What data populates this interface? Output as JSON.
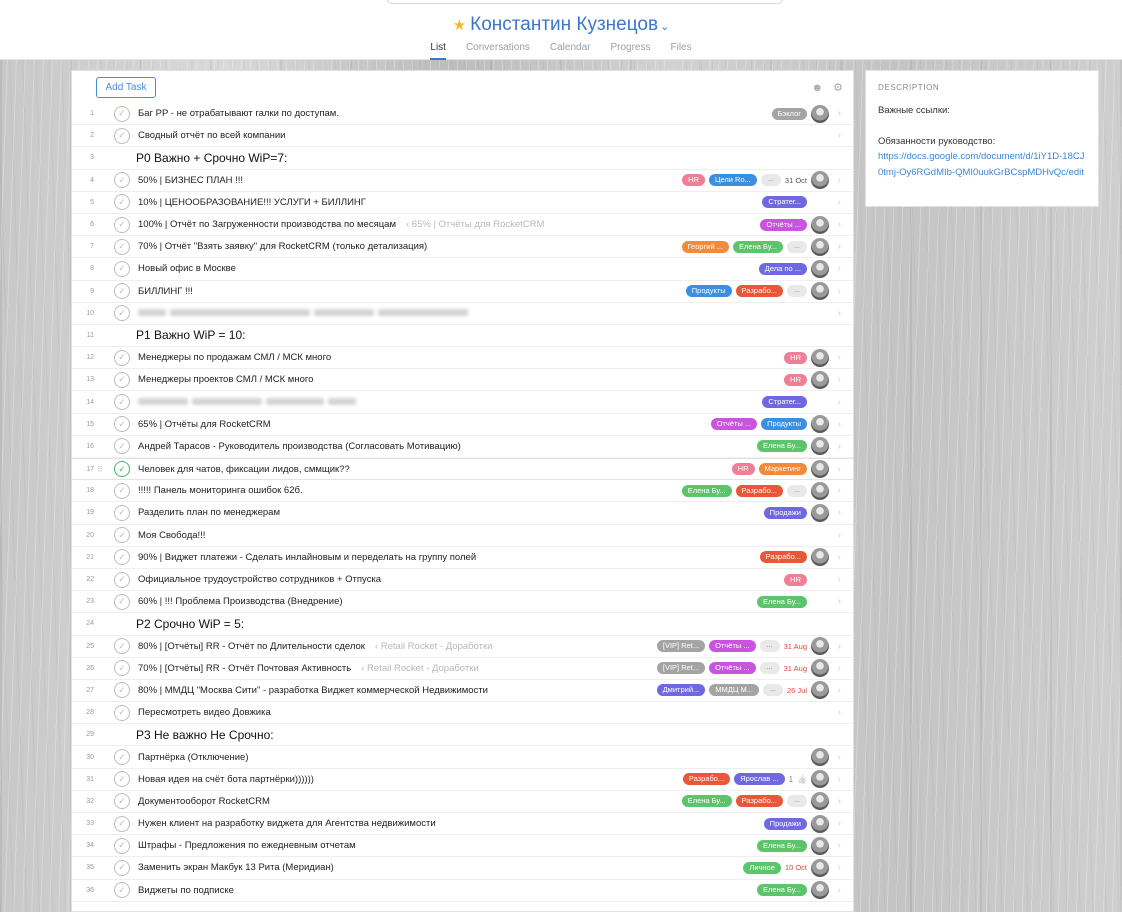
{
  "header": {
    "title": "Константин Кузнецов",
    "tabs": [
      {
        "label": "List",
        "active": true
      },
      {
        "label": "Conversations",
        "active": false
      },
      {
        "label": "Calendar",
        "active": false
      },
      {
        "label": "Progress",
        "active": false
      },
      {
        "label": "Files",
        "active": false
      }
    ]
  },
  "toolbar": {
    "add_task_label": "Add Task",
    "icons": [
      "person-icon",
      "gear-icon"
    ]
  },
  "colors": {
    "accent": "#3a78c9",
    "gray": "#a4a4a4",
    "orange": "#f08a3c",
    "green": "#5cc46a",
    "blue": "#3a8fe0",
    "purple": "#7068e0",
    "magenta": "#c955de",
    "pink": "#ef7e96",
    "red": "#e9573a"
  },
  "rows": [
    {
      "n": "1",
      "text": "Баг PP - не отрабатывают галки по доступам.",
      "tags": [
        {
          "label": "Бэклог",
          "color": "gray"
        }
      ],
      "avatar": true
    },
    {
      "n": "2",
      "text": "Сводный отчёт по всей компании",
      "tags": [],
      "avatar": false
    },
    {
      "n": "3",
      "section": "P0 Важно + Срочно WiP=7:"
    },
    {
      "n": "4",
      "text": "50% | БИЗНЕС ПЛАН !!!",
      "tags": [
        {
          "label": "HR",
          "color": "pink"
        },
        {
          "label": "Цели Ro...",
          "color": "blue"
        }
      ],
      "more": "...",
      "date": "31 Oct",
      "avatar": true
    },
    {
      "n": "5",
      "text": "10% | ЦЕНООБРАЗОВАНИЕ!!! УСЛУГИ + БИЛЛИНГ",
      "tags": [
        {
          "label": "Стратег...",
          "color": "purple"
        }
      ],
      "avatar": false
    },
    {
      "n": "6",
      "text": "100% | Отчёт по Загруженности производства по месяцам",
      "ref": "‹ 65% | Отчёты для RocketCRM",
      "tags": [
        {
          "label": "Отчёты ...",
          "color": "magenta"
        }
      ],
      "avatar": true
    },
    {
      "n": "7",
      "text": "70% | Отчёт \"Взять заявку\" для RocketCRM (только детализация)",
      "tags": [
        {
          "label": "Георгий ...",
          "color": "orange"
        },
        {
          "label": "Елена Бу...",
          "color": "green"
        }
      ],
      "more": "...",
      "avatar": true
    },
    {
      "n": "8",
      "text": "Новый офис в Москве",
      "tags": [
        {
          "label": "Дела по ...",
          "color": "purple"
        }
      ],
      "avatar": true
    },
    {
      "n": "9",
      "text": "БИЛЛИНГ !!!",
      "tags": [
        {
          "label": "Продукты",
          "color": "blue"
        },
        {
          "label": "Разрабо...",
          "color": "red"
        }
      ],
      "more": "...",
      "avatar": true
    },
    {
      "n": "10",
      "blurred": true,
      "tags": [],
      "avatar": false
    },
    {
      "n": "11",
      "section": "P1 Важно WiP = 10:"
    },
    {
      "n": "12",
      "text": "Менеджеры по продажам СМЛ / МСК много",
      "tags": [
        {
          "label": "HR",
          "color": "pink"
        }
      ],
      "avatar": true
    },
    {
      "n": "13",
      "text": "Менеджеры проектов СМЛ / МСК много",
      "tags": [
        {
          "label": "HR",
          "color": "pink"
        }
      ],
      "avatar": true
    },
    {
      "n": "14",
      "blurred": true,
      "tags": [
        {
          "label": "Стратег...",
          "color": "purple"
        }
      ],
      "avatar": false
    },
    {
      "n": "15",
      "text": "65% | Отчёты для RocketCRM",
      "tags": [
        {
          "label": "Отчёты ...",
          "color": "magenta"
        },
        {
          "label": "Продукты",
          "color": "blue"
        }
      ],
      "avatar": true
    },
    {
      "n": "16",
      "text": "Андрей Тарасов - Руководитель производства (Согласовать Мотивацию)",
      "tags": [
        {
          "label": "Елена Бу...",
          "color": "green"
        }
      ],
      "avatar": true
    },
    {
      "n": "17",
      "text": "Человек для чатов, фиксации лидов, сммщик??",
      "tags": [
        {
          "label": "HR",
          "color": "pink"
        },
        {
          "label": "Маркетинг",
          "color": "orange"
        }
      ],
      "avatar": true,
      "active": true
    },
    {
      "n": "18",
      "text": "!!!!! Панель мониторинга ошибок 62б.",
      "tags": [
        {
          "label": "Елена Бу...",
          "color": "green"
        },
        {
          "label": "Разрабо...",
          "color": "red"
        }
      ],
      "more": "...",
      "avatar": true
    },
    {
      "n": "19",
      "text": "Разделить план по менеджерам",
      "tags": [
        {
          "label": "Продажи",
          "color": "purple"
        }
      ],
      "avatar": true
    },
    {
      "n": "20",
      "text": "Моя Свобода!!!",
      "tags": [],
      "avatar": false
    },
    {
      "n": "21",
      "text": "90% | Виджет платежи - Сделать инлайновым и переделать на группу полей",
      "tags": [
        {
          "label": "Разрабо...",
          "color": "red"
        }
      ],
      "avatar": true
    },
    {
      "n": "22",
      "text": "Официальное трудоустройство сотрудников + Отпуска",
      "tags": [
        {
          "label": "HR",
          "color": "pink"
        }
      ],
      "avatar": false
    },
    {
      "n": "23",
      "text": "60% | !!! Проблема Производства (Внедрение)",
      "tags": [
        {
          "label": "Елена Бу...",
          "color": "green"
        }
      ],
      "avatar": false
    },
    {
      "n": "24",
      "section": "P2 Срочно WiP = 5:"
    },
    {
      "n": "25",
      "text": "80% | [Отчёты] RR - Отчёт по Длительности сделок",
      "ref": "‹ Retail Rocket - Доработки",
      "tags": [
        {
          "label": "[VIP] Ret...",
          "color": "gray"
        },
        {
          "label": "Отчёты ...",
          "color": "magenta"
        }
      ],
      "more": "...",
      "date": "31 Aug",
      "date_red": true,
      "avatar": true
    },
    {
      "n": "26",
      "text": "70% | [Отчёты] RR - Отчёт Почтовая Активность",
      "ref": "‹ Retail Rocket - Доработки",
      "tags": [
        {
          "label": "[VIP] Ret...",
          "color": "gray"
        },
        {
          "label": "Отчёты ...",
          "color": "magenta"
        }
      ],
      "more": "...",
      "date": "31 Aug",
      "date_red": true,
      "avatar": true
    },
    {
      "n": "27",
      "text": "80% | ММДЦ \"Москва Сити\" - разработка Виджет коммерческой Недвижимости",
      "tags": [
        {
          "label": "Дмитрий...",
          "color": "purple"
        },
        {
          "label": "ММДЦ М...",
          "color": "gray"
        }
      ],
      "more": "...",
      "date": "26 Jul",
      "date_red": true,
      "avatar": true
    },
    {
      "n": "28",
      "text": "Пересмотреть видео Довжика",
      "tags": [],
      "avatar": false
    },
    {
      "n": "29",
      "section": "P3 Не важно Не Срочно:"
    },
    {
      "n": "30",
      "text": "Партнёрка (Отключение)",
      "tags": [],
      "avatar": true
    },
    {
      "n": "31",
      "text": "Новая идея на счёт бота партнёрки))))))",
      "tags": [
        {
          "label": "Разрабо...",
          "color": "red"
        },
        {
          "label": "Ярослав ...",
          "color": "purple"
        }
      ],
      "likes": "1",
      "avatar": true
    },
    {
      "n": "32",
      "text": "Документооборот RocketCRM",
      "tags": [
        {
          "label": "Елена Бу...",
          "color": "green"
        },
        {
          "label": "Разрабо...",
          "color": "red"
        }
      ],
      "more": "...",
      "avatar": true
    },
    {
      "n": "33",
      "text": "Нужен клиент на разработку виджета для Агентства недвижимости",
      "tags": [
        {
          "label": "Продажи",
          "color": "purple"
        }
      ],
      "avatar": true
    },
    {
      "n": "34",
      "text": "Штрафы - Предложения по ежедневным отчетам",
      "tags": [
        {
          "label": "Елена Бу...",
          "color": "green"
        }
      ],
      "avatar": true
    },
    {
      "n": "35",
      "text": "Заменить экран Макбук 13 Рита (Меридиан)",
      "tags": [
        {
          "label": "Личное",
          "color": "green"
        }
      ],
      "date": "10 Oct",
      "date_red": true,
      "avatar": true
    },
    {
      "n": "36",
      "text": "Виджеты по подписке",
      "tags": [
        {
          "label": "Елена Бу...",
          "color": "green"
        }
      ],
      "avatar": true
    }
  ],
  "description": {
    "heading": "DESCRIPTION",
    "line1": "Важные ссылки:",
    "line2": "Обязанности руководство:",
    "link": "https://docs.google.com/document/d/1iY1D-18CJ0tmj-Oy6RGdMIb-QMI0uukGrBCspMDHvQc/edit"
  }
}
